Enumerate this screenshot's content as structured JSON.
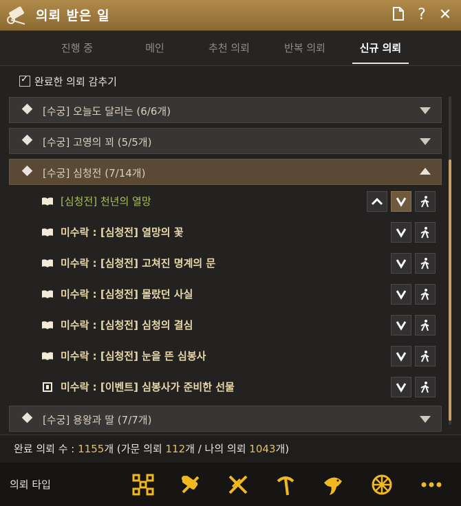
{
  "title": "의뢰 받은 일",
  "tabs": [
    "진행 중",
    "메인",
    "추천 의뢰",
    "반복 의뢰",
    "신규 의뢰"
  ],
  "active_tab": "신규 의뢰",
  "hide_completed_label": "완료한 의뢰 감추기",
  "groups": [
    {
      "title": "[수궁] 오늘도 달리는 (6/6개)",
      "expanded": false
    },
    {
      "title": "[수궁] 고영의 꾀 (5/5개)",
      "expanded": false
    },
    {
      "title": "[수궁] 심청전 (7/14개)",
      "expanded": true
    },
    {
      "title": "[수궁] 용왕과 딸 (7/7개)",
      "expanded": false
    }
  ],
  "quests": [
    {
      "text": "[심청전] 천년의 열망",
      "icon": "book-icon",
      "current": true
    },
    {
      "text": "미수락 : [심청전] 열망의 꽃",
      "icon": "book-icon"
    },
    {
      "text": "미수락 : [심청전] 고쳐진 명계의 문",
      "icon": "book-icon"
    },
    {
      "text": "미수락 : [심청전] 몰랐던 사실",
      "icon": "book-icon"
    },
    {
      "text": "미수락 : [심청전] 심청의 결심",
      "icon": "book-icon"
    },
    {
      "text": "미수락 : [심청전] 눈을 뜬 심봉사",
      "icon": "book-icon"
    },
    {
      "text": "미수락 : [이벤트] 심봉사가 준비한 선물",
      "icon": "event-scroll-icon"
    }
  ],
  "summary": {
    "prefix": "완료 의뢰 수 : ",
    "total": "1155",
    "mid1": "개 (가문 의뢰 ",
    "family": "112",
    "mid2": "개 / 나의 의뢰 ",
    "mine": "1043",
    "suffix": "개)"
  },
  "footer_label": "의뢰 타입",
  "footer_icons": [
    "nodes-icon",
    "scroll-tools-icon",
    "crossed-swords-icon",
    "pickaxe-icon",
    "fish-icon",
    "wheel-icon",
    "more-icon"
  ],
  "colors": {
    "accent": "#c4a06a",
    "title_bar": "#9c7a3e",
    "footer_icon": "#f2b820",
    "current_quest": "#a8c050",
    "quest_text": "#e8d8a8"
  }
}
